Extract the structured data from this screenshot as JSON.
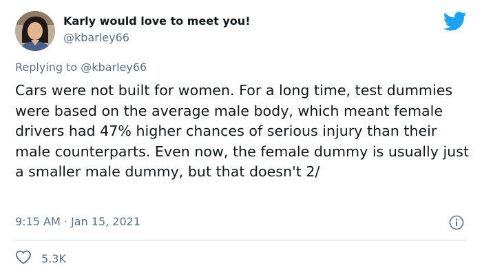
{
  "author": {
    "display_name": "Karly would love to meet you!",
    "handle": "@kbarley66"
  },
  "reply": {
    "prefix": "Replying to ",
    "mention": "@kbarley66"
  },
  "tweet_text": "Cars were not built for women. For a long time, test dummies were based on the average male body, which meant female drivers had 47% higher chances of serious injury than their male counterparts. Even now, the female dummy is usually just a smaller male dummy, but that doesn't 2/",
  "timestamp": "9:15 AM · Jan 15, 2021",
  "likes": "5.3K",
  "icons": {
    "brand": "twitter-bird-icon",
    "info": "info-icon",
    "like": "heart-icon"
  },
  "colors": {
    "brand_blue": "#1da1f2",
    "secondary_text": "#5b7083",
    "divider": "#cfd9de"
  }
}
